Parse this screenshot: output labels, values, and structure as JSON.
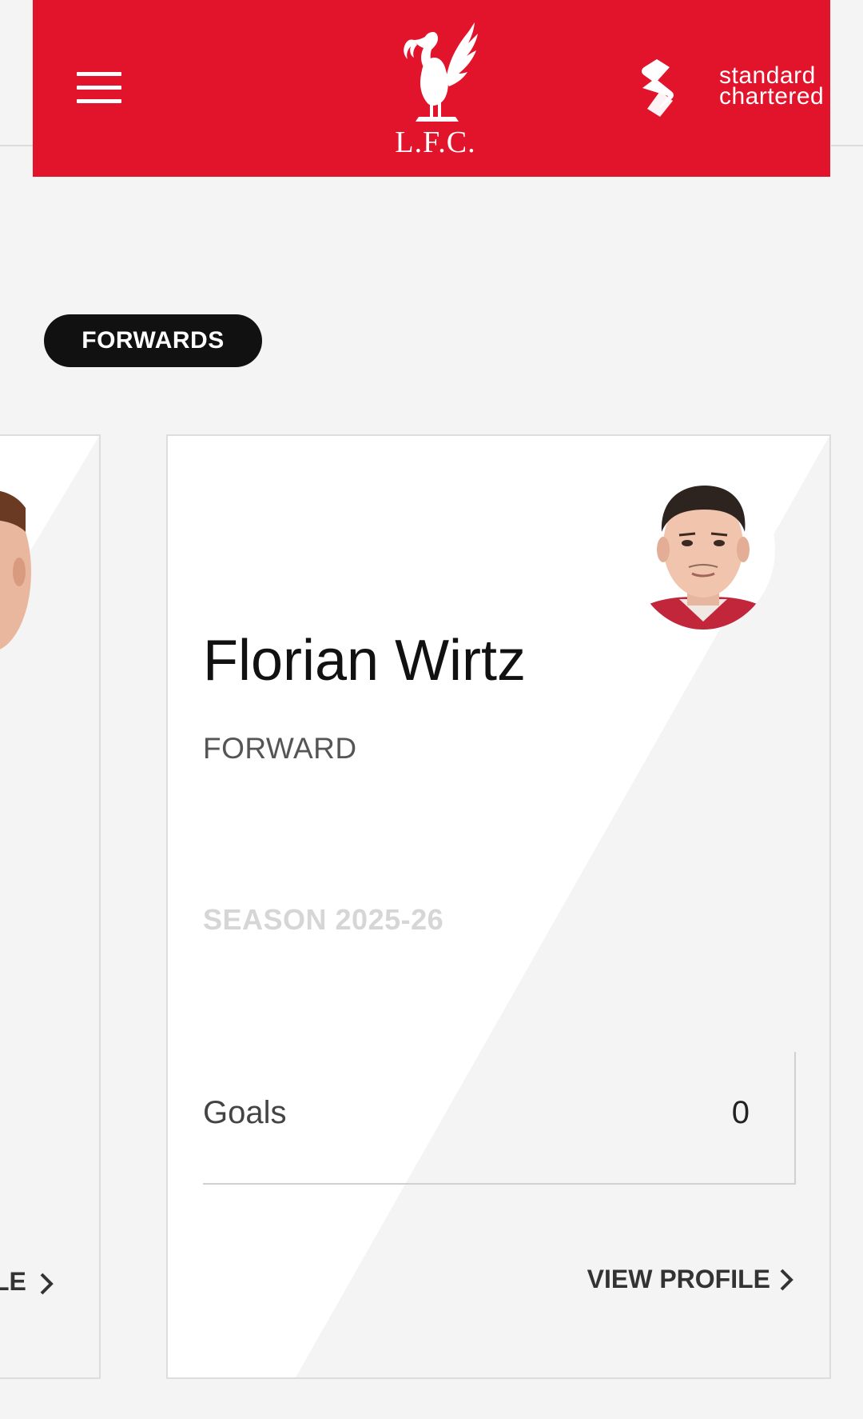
{
  "header": {
    "crest_text": "L.F.C.",
    "sponsor_name": "standard chartered",
    "background_color": "#e1142c"
  },
  "section": {
    "label": "FORWARDS"
  },
  "left_card": {
    "link_text": "LE"
  },
  "player": {
    "name": "Florian Wirtz",
    "position": "FORWARD",
    "season_label": "SEASON 2025-26",
    "stat_label": "Goals",
    "stat_value": "0",
    "view_profile_label": "VIEW PROFILE"
  },
  "icons": {
    "menu": "hamburger-menu-icon",
    "crest": "liverbird-crest-icon",
    "sponsor": "standard-chartered-logo-icon",
    "chevron": "chevron-right-icon"
  }
}
